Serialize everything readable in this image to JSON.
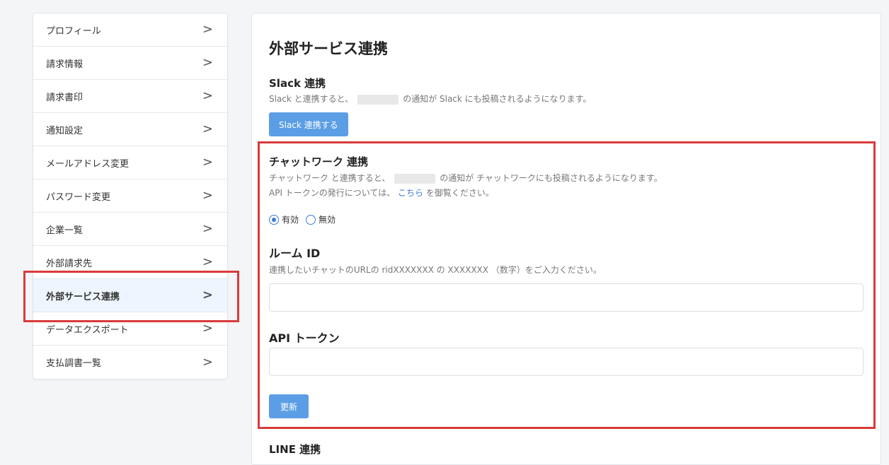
{
  "sidebar": {
    "items": [
      {
        "label": "プロフィール"
      },
      {
        "label": "請求情報"
      },
      {
        "label": "請求書印"
      },
      {
        "label": "通知設定"
      },
      {
        "label": "メールアドレス変更"
      },
      {
        "label": "パスワード変更"
      },
      {
        "label": "企業一覧"
      },
      {
        "label": "外部請求先"
      },
      {
        "label": "外部サービス連携",
        "active": true
      },
      {
        "label": "データエクスポート"
      },
      {
        "label": "支払調書一覧"
      }
    ],
    "chevron": ">"
  },
  "main": {
    "title": "外部サービス連携",
    "slack": {
      "title": "Slack 連携",
      "desc_pre": "Slack と連携すると、",
      "desc_post": "の通知が Slack にも投稿されるようになります。",
      "button": "Slack 連携する"
    },
    "chatwork": {
      "title": "チャットワーク 連携",
      "desc_pre": "チャットワーク と連携すると、",
      "desc_post": "の通知が チャットワークにも投稿されるようになります。",
      "api_note_pre": "API トークンの発行については、",
      "api_note_link": "こちら",
      "api_note_post": "を御覧ください。",
      "radio_enabled": "有効",
      "radio_disabled": "無効",
      "room_id_label": "ルーム ID",
      "room_id_desc": "連携したいチャットのURLの ridXXXXXXX の XXXXXXX （数字）をご入力ください。",
      "room_id_value": "",
      "api_token_label": "API トークン",
      "api_token_value": "",
      "update_button": "更新"
    },
    "line": {
      "title": "LINE 連携"
    }
  },
  "colors": {
    "accent": "#5b9ee5",
    "highlight": "#d93b3b",
    "active_bg": "#eef5fe"
  }
}
